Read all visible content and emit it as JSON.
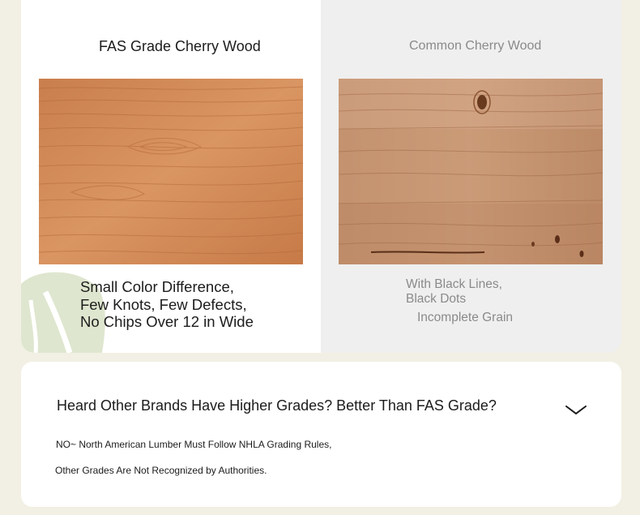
{
  "comparison": {
    "left": {
      "title": "FAS Grade Cherry Wood",
      "image": "fas-cherry-wood-image",
      "features": [
        "Small Color Difference,",
        "Few Knots, Few Defects,",
        "No Chips Over 12 in Wide"
      ]
    },
    "right": {
      "title": "Common Cherry Wood",
      "image": "common-cherry-wood-image",
      "features": [
        "With Black Lines,",
        "Black Dots"
      ],
      "grain_note": "Incomplete Grain"
    }
  },
  "faq": {
    "question": "Heard Other Brands Have Higher Grades? Better Than FAS Grade?",
    "toggle_icon": "chevron-down-icon",
    "answer_lines": [
      "NO~ North American Lumber Must Follow NHLA Grading Rules,",
      "Other Grades Are Not Recognized by Authorities."
    ]
  },
  "colors": {
    "page_background": "#f2efe4",
    "card_background": "#ffffff",
    "muted_column": "#efefef",
    "muted_text": "#8a8a8a",
    "primary_text": "#1c1c1c",
    "leaf_accent": "#dfe6cf"
  }
}
